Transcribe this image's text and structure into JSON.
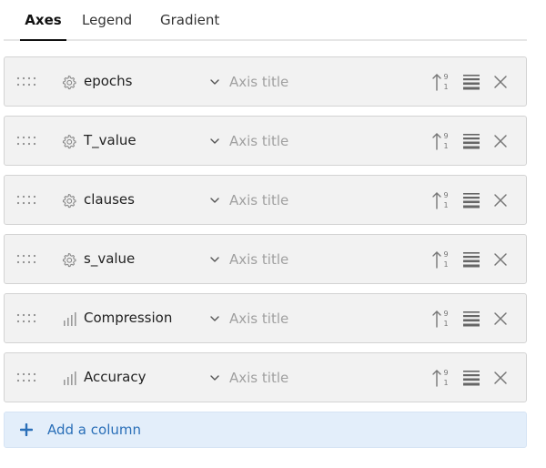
{
  "tabs": [
    {
      "label": "Axes",
      "active": true
    },
    {
      "label": "Legend",
      "active": false
    },
    {
      "label": "Gradient",
      "active": false
    }
  ],
  "rows": [
    {
      "name": "epochs",
      "type_icon": "gear-icon",
      "axis_title_placeholder": "Axis title",
      "axis_title_value": ""
    },
    {
      "name": "T_value",
      "type_icon": "gear-icon",
      "axis_title_placeholder": "Axis title",
      "axis_title_value": ""
    },
    {
      "name": "clauses",
      "type_icon": "gear-icon",
      "axis_title_placeholder": "Axis title",
      "axis_title_value": ""
    },
    {
      "name": "s_value",
      "type_icon": "gear-icon",
      "axis_title_placeholder": "Axis title",
      "axis_title_value": ""
    },
    {
      "name": "Compression",
      "type_icon": "bar-chart-icon",
      "axis_title_placeholder": "Axis title",
      "axis_title_value": ""
    },
    {
      "name": "Accuracy",
      "type_icon": "bar-chart-icon",
      "axis_title_placeholder": "Axis title",
      "axis_title_value": ""
    }
  ],
  "sort_icon_digits": {
    "top": "9",
    "bottom": "1"
  },
  "add_column": {
    "label": "Add a column",
    "icon": "plus-icon"
  },
  "colors": {
    "accent": "#2a6fb8",
    "row_background": "#f2f2f2",
    "add_background": "#e3eefa"
  }
}
